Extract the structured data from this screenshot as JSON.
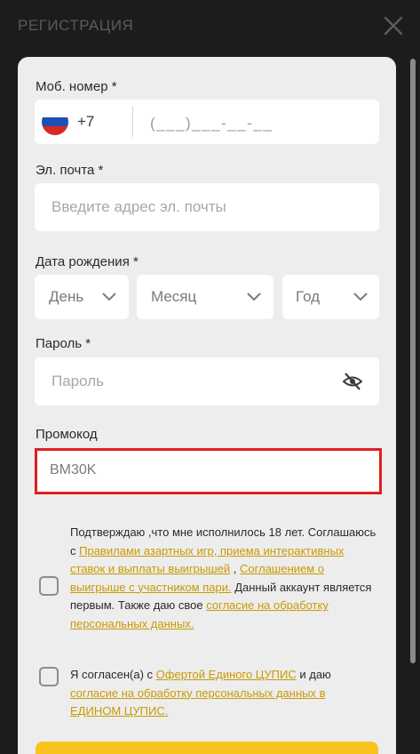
{
  "header": {
    "title": "РЕГИСТРАЦИЯ"
  },
  "phone": {
    "label": "Моб. номер *",
    "code": "+7",
    "placeholder": "(___)___-__-__"
  },
  "email": {
    "label": "Эл. почта *",
    "placeholder": "Введите адрес эл. почты"
  },
  "birth": {
    "label": "Дата рождения *",
    "day": "День",
    "month": "Месяц",
    "year": "Год"
  },
  "password": {
    "label": "Пароль *",
    "placeholder": "Пароль"
  },
  "promo": {
    "label": "Промокод",
    "value": "BM30K"
  },
  "consent1": {
    "t1": "Подтверждаю ,что мне исполнилось 18 лет. Соглашаюсь с ",
    "l1": "Правилами азартных игр, приема интерактивных ставок и выплаты выигрышей",
    "t2": " , ",
    "l2": "Соглашением о выигрыше с участником пари.",
    "t3": " Данный аккаунт является первым. Также даю свое ",
    "l3": "согласие на обработку персональных данных."
  },
  "consent2": {
    "t1": "Я согласен(а) с ",
    "l1": "Офертой Единого ЦУПИС",
    "t2": " и даю ",
    "l2": "согласие на обработку персональных данных в ЕДИНОМ ЦУПИС."
  },
  "colors": {
    "accent": "#f7c31c",
    "link": "#c99a00",
    "highlight": "#e01e1e"
  }
}
